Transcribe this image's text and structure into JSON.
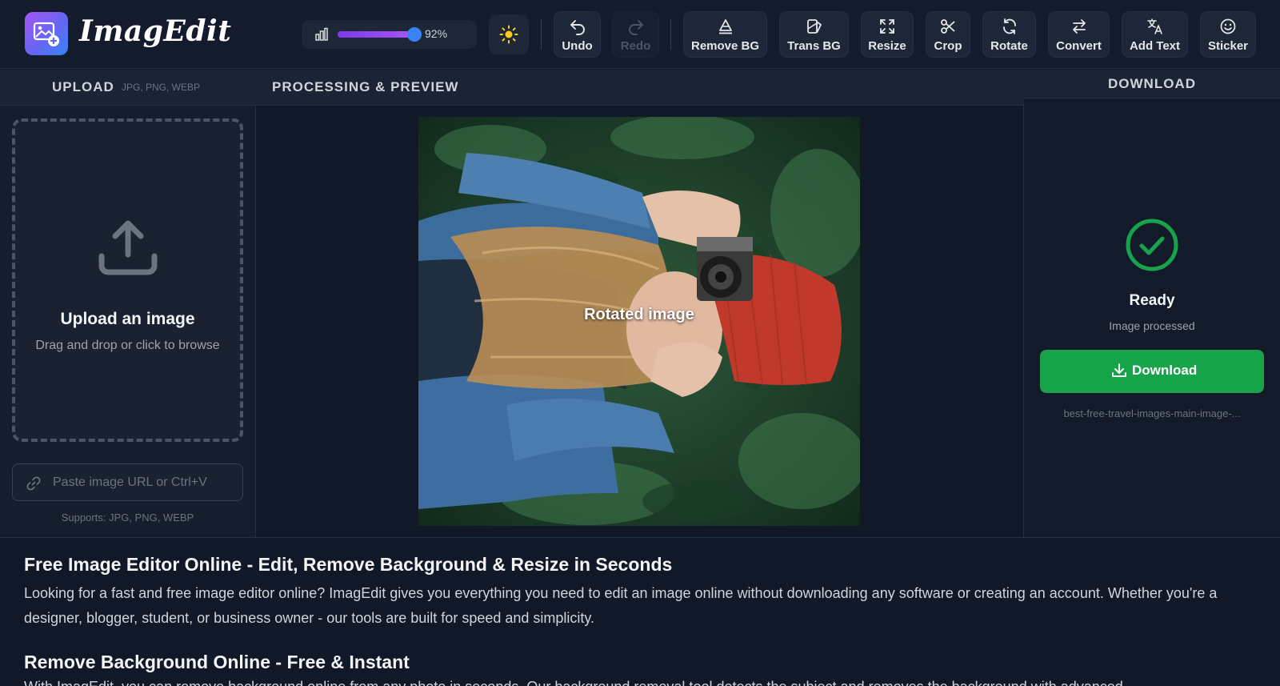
{
  "app": {
    "title": "ImagEdit"
  },
  "toolbar": {
    "zoom_value": "92%",
    "zoom_fraction": 0.92,
    "buttons": {
      "undo": "Undo",
      "redo": "Redo",
      "remove_bg": "Remove BG",
      "trans_bg": "Trans BG",
      "resize": "Resize",
      "crop": "Crop",
      "rotate": "Rotate",
      "convert": "Convert",
      "add_text": "Add Text",
      "sticker": "Sticker"
    }
  },
  "upload": {
    "title": "UPLOAD",
    "formats": "JPG, PNG, WEBP",
    "drop_title": "Upload an image",
    "drop_sub": "Drag and drop or click to browse",
    "url_placeholder": "Paste image URL or Ctrl+V",
    "supports": "Supports: JPG, PNG, WEBP"
  },
  "processing": {
    "title": "PROCESSING & PREVIEW",
    "caption": "Rotated image"
  },
  "download": {
    "title": "DOWNLOAD",
    "status": "Ready",
    "status_sub": "Image processed",
    "button": "Download",
    "filename": "best-free-travel-images-main-image-..."
  },
  "article": {
    "h1": "Free Image Editor Online - Edit, Remove Background & Resize in Seconds",
    "p1": "Looking for a fast and free image editor online? ImagEdit gives you everything you need to edit an image online without downloading any software or creating an account. Whether you're a designer, blogger, student, or business owner - our tools are built for speed and simplicity.",
    "h2": "Remove Background Online - Free & Instant",
    "p2": "With ImagEdit, you can remove background online from any photo in seconds. Our background removal tool detects the subject and removes the background with advanced"
  },
  "colors": {
    "accent_purple": "#a855f7",
    "slider_thumb": "#3b82f6",
    "success_green": "#16a34a",
    "background": "#111827"
  },
  "icons": [
    "logo-icon",
    "zoom-bars-icon",
    "sun-icon",
    "undo-icon",
    "redo-icon",
    "remove-bg-icon",
    "trans-bg-icon",
    "resize-icon",
    "crop-icon",
    "rotate-icon",
    "convert-icon",
    "translate-icon",
    "smiley-icon",
    "upload-icon",
    "link-icon",
    "check-circle-icon",
    "download-icon"
  ]
}
